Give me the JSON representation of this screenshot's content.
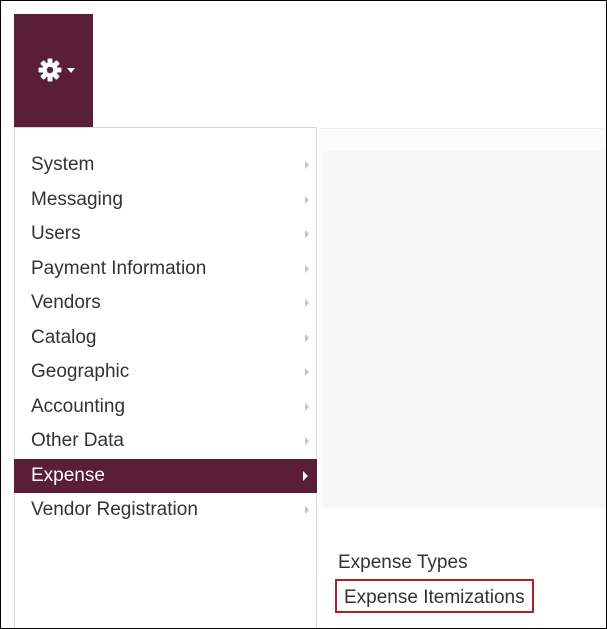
{
  "colors": {
    "accent": "#5a1f37",
    "highlight_border": "#b3202a",
    "text": "#333333"
  },
  "settings_button": {
    "icon": "gear-icon",
    "caret_icon": "caret-down-icon"
  },
  "menu": {
    "items": [
      {
        "label": "System",
        "has_submenu": true
      },
      {
        "label": "Messaging",
        "has_submenu": true
      },
      {
        "label": "Users",
        "has_submenu": true
      },
      {
        "label": "Payment Information",
        "has_submenu": true
      },
      {
        "label": "Vendors",
        "has_submenu": true
      },
      {
        "label": "Catalog",
        "has_submenu": true
      },
      {
        "label": "Geographic",
        "has_submenu": true
      },
      {
        "label": "Accounting",
        "has_submenu": true
      },
      {
        "label": "Other Data",
        "has_submenu": true
      },
      {
        "label": "Expense",
        "has_submenu": true,
        "active": true
      },
      {
        "label": "Vendor Registration",
        "has_submenu": true
      }
    ]
  },
  "submenu": {
    "items": [
      {
        "label": "Expense Types"
      },
      {
        "label": "Expense Itemizations",
        "highlighted": true
      }
    ]
  }
}
